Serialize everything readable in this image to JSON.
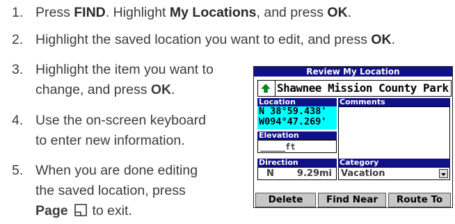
{
  "steps": [
    {
      "num": "1.",
      "pre": "Press ",
      "b1": "FIND",
      "mid": ". Highlight ",
      "b2": "My Locations",
      "mid2": ", and press ",
      "b3": "OK",
      "post": "."
    },
    {
      "num": "2.",
      "pre": "Highlight the saved location you want to edit, and press ",
      "b1": "OK",
      "post": "."
    },
    {
      "num": "3.",
      "line1": "Highlight the item you want to",
      "line2_pre": "change, and press ",
      "line2_b": "OK",
      "line2_post": "."
    },
    {
      "num": "4.",
      "line1": "Use the on-screen keyboard",
      "line2": "to enter new information."
    },
    {
      "num": "5.",
      "line1": "When you are done editing",
      "line2": "the saved location, press",
      "line3_b": "Page",
      "line3_post": " to exit."
    }
  ],
  "device": {
    "title": "Review My Location",
    "name": "Shawnee Mission County Park",
    "location_label": "Location",
    "comments_label": "Comments",
    "lat": "N  38°59.438'",
    "lon": "W094°47.269'",
    "elevation_label": "Elevation",
    "elevation_value": "_____ft",
    "direction_label": "Direction",
    "direction_dir": "N",
    "direction_dist": "9.29mi",
    "category_label": "Category",
    "category_value": "Vacation",
    "buttons": [
      "Delete",
      "Find Near",
      "Route To"
    ]
  }
}
